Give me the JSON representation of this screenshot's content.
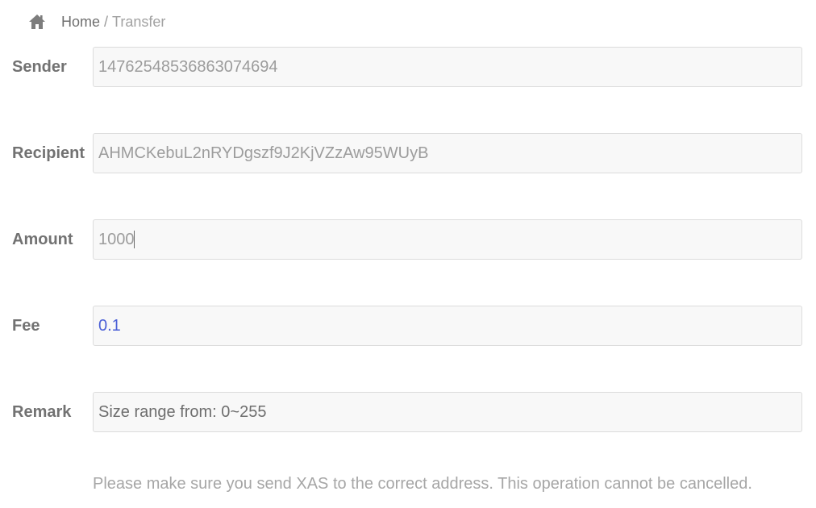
{
  "breadcrumb": {
    "home_icon": "home-icon",
    "home_label": "Home",
    "separator": "/",
    "current_label": "Transfer"
  },
  "form": {
    "sender": {
      "label": "Sender",
      "value": "14762548536863074694"
    },
    "recipient": {
      "label": "Recipient",
      "value": "AHMCKebuL2nRYDgszf9J2KjVZzAw95WUyB"
    },
    "amount": {
      "label": "Amount",
      "value": "1000"
    },
    "fee": {
      "label": "Fee",
      "value": "0.1"
    },
    "remark": {
      "label": "Remark",
      "placeholder": "Size range from: 0~255"
    }
  },
  "note": "Please make sure you send XAS to the correct address. This operation cannot be cancelled.",
  "colors": {
    "label": "#727272",
    "input_text": "#9c9c9c",
    "fee_text": "#4a5fd6",
    "input_background": "#f8f8f8",
    "input_border": "#dcdcdc"
  }
}
